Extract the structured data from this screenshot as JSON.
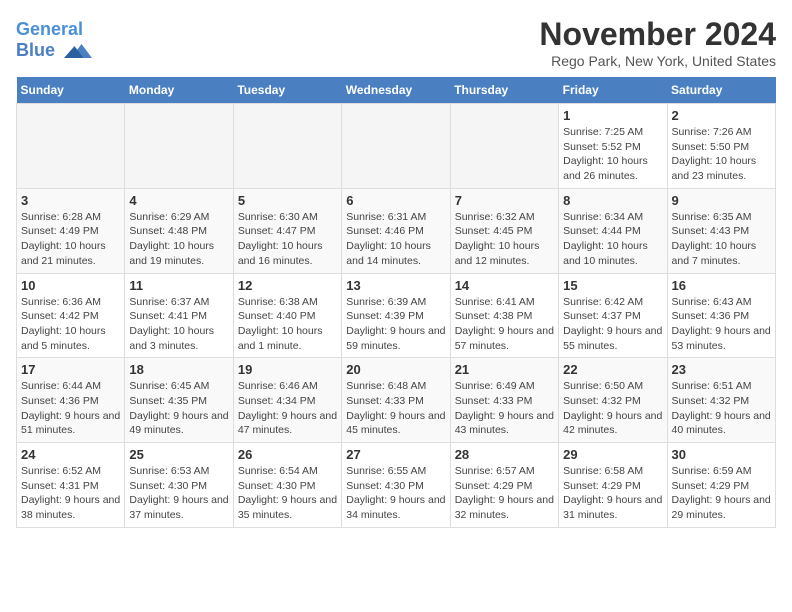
{
  "header": {
    "logo_line1": "General",
    "logo_line2": "Blue",
    "month": "November 2024",
    "location": "Rego Park, New York, United States"
  },
  "weekdays": [
    "Sunday",
    "Monday",
    "Tuesday",
    "Wednesday",
    "Thursday",
    "Friday",
    "Saturday"
  ],
  "weeks": [
    [
      {
        "day": "",
        "info": ""
      },
      {
        "day": "",
        "info": ""
      },
      {
        "day": "",
        "info": ""
      },
      {
        "day": "",
        "info": ""
      },
      {
        "day": "",
        "info": ""
      },
      {
        "day": "1",
        "info": "Sunrise: 7:25 AM\nSunset: 5:52 PM\nDaylight: 10 hours and 26 minutes."
      },
      {
        "day": "2",
        "info": "Sunrise: 7:26 AM\nSunset: 5:50 PM\nDaylight: 10 hours and 23 minutes."
      }
    ],
    [
      {
        "day": "3",
        "info": "Sunrise: 6:28 AM\nSunset: 4:49 PM\nDaylight: 10 hours and 21 minutes."
      },
      {
        "day": "4",
        "info": "Sunrise: 6:29 AM\nSunset: 4:48 PM\nDaylight: 10 hours and 19 minutes."
      },
      {
        "day": "5",
        "info": "Sunrise: 6:30 AM\nSunset: 4:47 PM\nDaylight: 10 hours and 16 minutes."
      },
      {
        "day": "6",
        "info": "Sunrise: 6:31 AM\nSunset: 4:46 PM\nDaylight: 10 hours and 14 minutes."
      },
      {
        "day": "7",
        "info": "Sunrise: 6:32 AM\nSunset: 4:45 PM\nDaylight: 10 hours and 12 minutes."
      },
      {
        "day": "8",
        "info": "Sunrise: 6:34 AM\nSunset: 4:44 PM\nDaylight: 10 hours and 10 minutes."
      },
      {
        "day": "9",
        "info": "Sunrise: 6:35 AM\nSunset: 4:43 PM\nDaylight: 10 hours and 7 minutes."
      }
    ],
    [
      {
        "day": "10",
        "info": "Sunrise: 6:36 AM\nSunset: 4:42 PM\nDaylight: 10 hours and 5 minutes."
      },
      {
        "day": "11",
        "info": "Sunrise: 6:37 AM\nSunset: 4:41 PM\nDaylight: 10 hours and 3 minutes."
      },
      {
        "day": "12",
        "info": "Sunrise: 6:38 AM\nSunset: 4:40 PM\nDaylight: 10 hours and 1 minute."
      },
      {
        "day": "13",
        "info": "Sunrise: 6:39 AM\nSunset: 4:39 PM\nDaylight: 9 hours and 59 minutes."
      },
      {
        "day": "14",
        "info": "Sunrise: 6:41 AM\nSunset: 4:38 PM\nDaylight: 9 hours and 57 minutes."
      },
      {
        "day": "15",
        "info": "Sunrise: 6:42 AM\nSunset: 4:37 PM\nDaylight: 9 hours and 55 minutes."
      },
      {
        "day": "16",
        "info": "Sunrise: 6:43 AM\nSunset: 4:36 PM\nDaylight: 9 hours and 53 minutes."
      }
    ],
    [
      {
        "day": "17",
        "info": "Sunrise: 6:44 AM\nSunset: 4:36 PM\nDaylight: 9 hours and 51 minutes."
      },
      {
        "day": "18",
        "info": "Sunrise: 6:45 AM\nSunset: 4:35 PM\nDaylight: 9 hours and 49 minutes."
      },
      {
        "day": "19",
        "info": "Sunrise: 6:46 AM\nSunset: 4:34 PM\nDaylight: 9 hours and 47 minutes."
      },
      {
        "day": "20",
        "info": "Sunrise: 6:48 AM\nSunset: 4:33 PM\nDaylight: 9 hours and 45 minutes."
      },
      {
        "day": "21",
        "info": "Sunrise: 6:49 AM\nSunset: 4:33 PM\nDaylight: 9 hours and 43 minutes."
      },
      {
        "day": "22",
        "info": "Sunrise: 6:50 AM\nSunset: 4:32 PM\nDaylight: 9 hours and 42 minutes."
      },
      {
        "day": "23",
        "info": "Sunrise: 6:51 AM\nSunset: 4:32 PM\nDaylight: 9 hours and 40 minutes."
      }
    ],
    [
      {
        "day": "24",
        "info": "Sunrise: 6:52 AM\nSunset: 4:31 PM\nDaylight: 9 hours and 38 minutes."
      },
      {
        "day": "25",
        "info": "Sunrise: 6:53 AM\nSunset: 4:30 PM\nDaylight: 9 hours and 37 minutes."
      },
      {
        "day": "26",
        "info": "Sunrise: 6:54 AM\nSunset: 4:30 PM\nDaylight: 9 hours and 35 minutes."
      },
      {
        "day": "27",
        "info": "Sunrise: 6:55 AM\nSunset: 4:30 PM\nDaylight: 9 hours and 34 minutes."
      },
      {
        "day": "28",
        "info": "Sunrise: 6:57 AM\nSunset: 4:29 PM\nDaylight: 9 hours and 32 minutes."
      },
      {
        "day": "29",
        "info": "Sunrise: 6:58 AM\nSunset: 4:29 PM\nDaylight: 9 hours and 31 minutes."
      },
      {
        "day": "30",
        "info": "Sunrise: 6:59 AM\nSunset: 4:29 PM\nDaylight: 9 hours and 29 minutes."
      }
    ]
  ]
}
